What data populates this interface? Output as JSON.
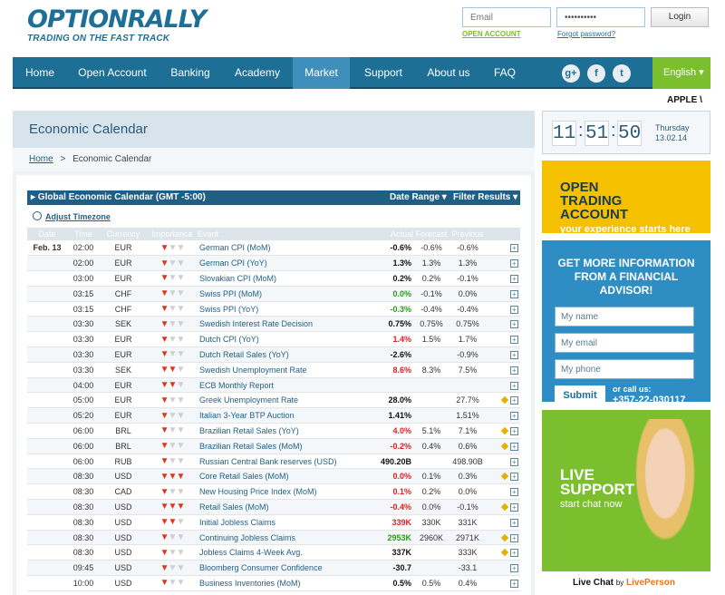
{
  "logo": {
    "brand": "OPTIONRALLY",
    "tagline": "TRADING ON THE FAST TRACK"
  },
  "login": {
    "email_placeholder": "Email",
    "password_value": "••••••••••",
    "button": "Login",
    "open_account": "OPEN ACCOUNT",
    "forgot": "Forgot password?"
  },
  "nav": {
    "items": [
      "Home",
      "Open Account",
      "Banking",
      "Academy",
      "Market",
      "Support",
      "About us",
      "FAQ"
    ],
    "active": "Market",
    "language": "English ▾"
  },
  "social": {
    "gplus": "g+",
    "facebook": "f",
    "twitter": "t"
  },
  "ticker": "APPLE \\",
  "page": {
    "title": "Economic Calendar",
    "breadcrumb_home": "Home",
    "breadcrumb_sep": ">",
    "breadcrumb_current": "Economic Calendar"
  },
  "calendar": {
    "bar_title": "▸ Global Economic Calendar (GMT -5:00)",
    "date_range": "Date Range ▾",
    "filter": "Filter Results ▾",
    "adjust_tz": "Adjust Timezone",
    "columns": [
      "Date",
      "Time",
      "Currency",
      "Importance",
      "Event",
      "Actual",
      "Forecast",
      "Previous"
    ],
    "rows": [
      {
        "date": "Feb. 13",
        "time": "02:00",
        "cur": "EUR",
        "imp": 1,
        "event": "German CPI (MoM)",
        "actual": "-0.6%",
        "ac": "#111",
        "forecast": "-0.6%",
        "previous": "-0.6%",
        "flag": false
      },
      {
        "date": "",
        "time": "02:00",
        "cur": "EUR",
        "imp": 1,
        "event": "German CPI (YoY)",
        "actual": "1.3%",
        "ac": "#111",
        "forecast": "1.3%",
        "previous": "1.3%",
        "flag": false
      },
      {
        "date": "",
        "time": "03:00",
        "cur": "EUR",
        "imp": 1,
        "event": "Slovakian CPI (MoM)",
        "actual": "0.2%",
        "ac": "#111",
        "forecast": "0.2%",
        "previous": "-0.1%",
        "flag": false
      },
      {
        "date": "",
        "time": "03:15",
        "cur": "CHF",
        "imp": 1,
        "event": "Swiss PPI (MoM)",
        "actual": "0.0%",
        "ac": "#2a9a1a",
        "forecast": "-0.1%",
        "previous": "0.0%",
        "flag": false
      },
      {
        "date": "",
        "time": "03:15",
        "cur": "CHF",
        "imp": 1,
        "event": "Swiss PPI (YoY)",
        "actual": "-0.3%",
        "ac": "#2a9a1a",
        "forecast": "-0.4%",
        "previous": "-0.4%",
        "flag": false
      },
      {
        "date": "",
        "time": "03:30",
        "cur": "SEK",
        "imp": 1,
        "event": "Swedish Interest Rate Decision",
        "actual": "0.75%",
        "ac": "#111",
        "forecast": "0.75%",
        "previous": "0.75%",
        "flag": false
      },
      {
        "date": "",
        "time": "03:30",
        "cur": "EUR",
        "imp": 1,
        "event": "Dutch CPI (YoY)",
        "actual": "1.4%",
        "ac": "#e02020",
        "forecast": "1.5%",
        "previous": "1.7%",
        "flag": false
      },
      {
        "date": "",
        "time": "03:30",
        "cur": "EUR",
        "imp": 1,
        "event": "Dutch Retail Sales (YoY)",
        "actual": "-2.6%",
        "ac": "#111",
        "forecast": "",
        "previous": "-0.9%",
        "flag": false
      },
      {
        "date": "",
        "time": "03:30",
        "cur": "SEK",
        "imp": 2,
        "event": "Swedish Unemployment Rate",
        "actual": "8.6%",
        "ac": "#e02020",
        "forecast": "8.3%",
        "previous": "7.5%",
        "flag": false
      },
      {
        "date": "",
        "time": "04:00",
        "cur": "EUR",
        "imp": 2,
        "event": "ECB Monthly Report",
        "actual": "",
        "ac": "#111",
        "forecast": "",
        "previous": "",
        "flag": false
      },
      {
        "date": "",
        "time": "05:00",
        "cur": "EUR",
        "imp": 1,
        "event": "Greek Unemployment Rate",
        "actual": "28.0%",
        "ac": "#111",
        "forecast": "",
        "previous": "27.7%",
        "flag": true
      },
      {
        "date": "",
        "time": "05:20",
        "cur": "EUR",
        "imp": 1,
        "event": "Italian 3-Year BTP Auction",
        "actual": "1.41%",
        "ac": "#111",
        "forecast": "",
        "previous": "1.51%",
        "flag": false
      },
      {
        "date": "",
        "time": "06:00",
        "cur": "BRL",
        "imp": 1,
        "event": "Brazilian Retail Sales (YoY)",
        "actual": "4.0%",
        "ac": "#e02020",
        "forecast": "5.1%",
        "previous": "7.1%",
        "flag": true
      },
      {
        "date": "",
        "time": "06:00",
        "cur": "BRL",
        "imp": 1,
        "event": "Brazilian Retail Sales (MoM)",
        "actual": "-0.2%",
        "ac": "#e02020",
        "forecast": "0.4%",
        "previous": "0.6%",
        "flag": true
      },
      {
        "date": "",
        "time": "06:00",
        "cur": "RUB",
        "imp": 1,
        "event": "Russian Central Bank reserves (USD)",
        "actual": "490.20B",
        "ac": "#111",
        "forecast": "",
        "previous": "498.90B",
        "flag": false
      },
      {
        "date": "",
        "time": "08:30",
        "cur": "USD",
        "imp": 3,
        "event": "Core Retail Sales (MoM)",
        "actual": "0.0%",
        "ac": "#e02020",
        "forecast": "0.1%",
        "previous": "0.3%",
        "flag": true
      },
      {
        "date": "",
        "time": "08:30",
        "cur": "CAD",
        "imp": 1,
        "event": "New Housing Price Index (MoM)",
        "actual": "0.1%",
        "ac": "#e02020",
        "forecast": "0.2%",
        "previous": "0.0%",
        "flag": false
      },
      {
        "date": "",
        "time": "08:30",
        "cur": "USD",
        "imp": 3,
        "event": "Retail Sales (MoM)",
        "actual": "-0.4%",
        "ac": "#e02020",
        "forecast": "0.0%",
        "previous": "-0.1%",
        "flag": true
      },
      {
        "date": "",
        "time": "08:30",
        "cur": "USD",
        "imp": 2,
        "event": "Initial Jobless Claims",
        "actual": "339K",
        "ac": "#e02020",
        "forecast": "330K",
        "previous": "331K",
        "flag": false
      },
      {
        "date": "",
        "time": "08:30",
        "cur": "USD",
        "imp": 1,
        "event": "Continuing Jobless Claims",
        "actual": "2953K",
        "ac": "#2a9a1a",
        "forecast": "2960K",
        "previous": "2971K",
        "flag": true
      },
      {
        "date": "",
        "time": "08:30",
        "cur": "USD",
        "imp": 1,
        "event": "Jobless Claims 4-Week Avg.",
        "actual": "337K",
        "ac": "#111",
        "forecast": "",
        "previous": "333K",
        "flag": true
      },
      {
        "date": "",
        "time": "09:45",
        "cur": "USD",
        "imp": 1,
        "event": "Bloomberg Consumer Confidence",
        "actual": "-30.7",
        "ac": "#111",
        "forecast": "",
        "previous": "-33.1",
        "flag": false
      },
      {
        "date": "",
        "time": "10:00",
        "cur": "USD",
        "imp": 1,
        "event": "Business Inventories (MoM)",
        "actual": "0.5%",
        "ac": "#111",
        "forecast": "0.5%",
        "previous": "0.4%",
        "flag": false
      }
    ]
  },
  "clock": {
    "h": "11",
    "m": "51",
    "s": "50",
    "day": "Thursday",
    "date": "13.02.14"
  },
  "promo": {
    "line1": "OPEN",
    "line2": "TRADING ACCOUNT",
    "line3": "your experience starts here"
  },
  "form": {
    "heading1": "GET MORE INFORMATION",
    "heading2": "FROM A FINANCIAL ADVISOR!",
    "name": "My name",
    "email": "My email",
    "phone": "My phone",
    "submit": "Submit",
    "call": "or call us:",
    "phone_number": "+357-22-030117"
  },
  "support": {
    "line1": "LIVE",
    "line2": "SUPPORT",
    "line3": "start chat now",
    "caption": "Live Chat",
    "by": "by",
    "brand": "LivePerson"
  },
  "colors": {
    "primary": "#1d6f95",
    "accent_green": "#7bbf2e",
    "promo_yellow": "#f4c000",
    "form_blue": "#2e8dc2"
  }
}
